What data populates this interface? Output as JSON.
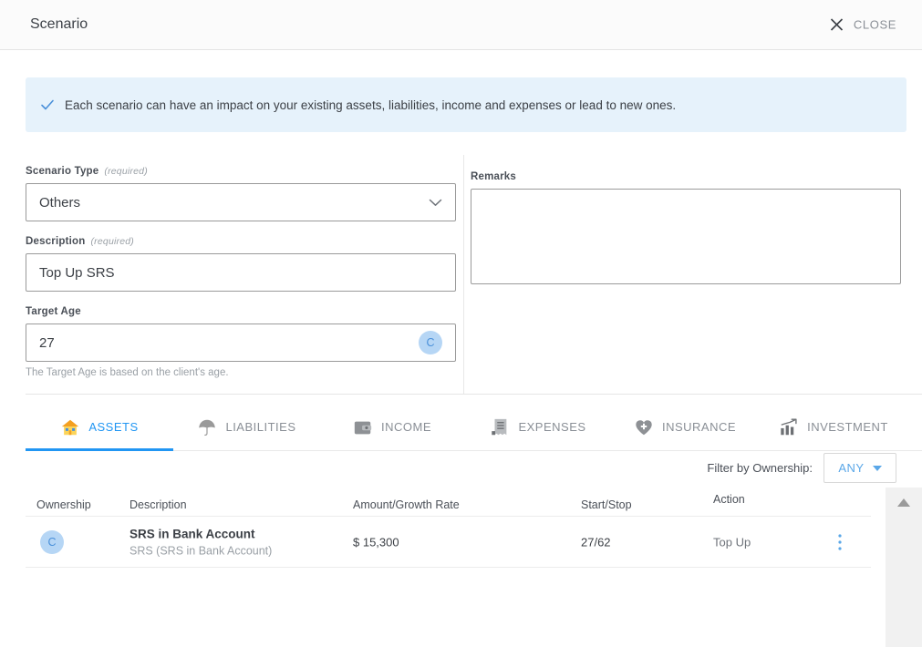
{
  "header": {
    "title": "Scenario",
    "close_label": "CLOSE"
  },
  "banner": {
    "text": "Each scenario can have an impact on your existing assets, liabilities, income and expenses or lead to new ones."
  },
  "form": {
    "scenario_type": {
      "label": "Scenario Type",
      "required_note": "(required)",
      "value": "Others"
    },
    "description": {
      "label": "Description",
      "required_note": "(required)",
      "value": "Top Up SRS"
    },
    "target_age": {
      "label": "Target Age",
      "value": "27",
      "avatar": "C",
      "helper": "The Target Age is based on the client's age."
    },
    "remarks": {
      "label": "Remarks",
      "value": ""
    }
  },
  "tabs": [
    {
      "label": "ASSETS",
      "icon": "house-icon",
      "active": true
    },
    {
      "label": "LIABILITIES",
      "icon": "umbrella-icon",
      "active": false
    },
    {
      "label": "INCOME",
      "icon": "wallet-icon",
      "active": false
    },
    {
      "label": "EXPENSES",
      "icon": "receipt-icon",
      "active": false
    },
    {
      "label": "INSURANCE",
      "icon": "heart-plus-icon",
      "active": false
    },
    {
      "label": "INVESTMENT",
      "icon": "chart-arrow-icon",
      "active": false
    }
  ],
  "filter": {
    "label": "Filter by Ownership:",
    "value": "ANY"
  },
  "table": {
    "columns": [
      "Ownership",
      "Description",
      "Amount/Growth Rate",
      "Start/Stop",
      "Action"
    ],
    "rows": [
      {
        "ownership": "C",
        "description_main": "SRS in Bank Account",
        "description_sub": "SRS (SRS in Bank Account)",
        "amount": "$ 15,300",
        "start_stop": "27/62",
        "action": "Top Up"
      }
    ]
  },
  "colors": {
    "accent": "#2196f3",
    "banner_bg": "#e6f2fb",
    "avatar_bg": "#b6d6f5",
    "avatar_fg": "#4a90d9",
    "muted": "#8a8f96"
  }
}
